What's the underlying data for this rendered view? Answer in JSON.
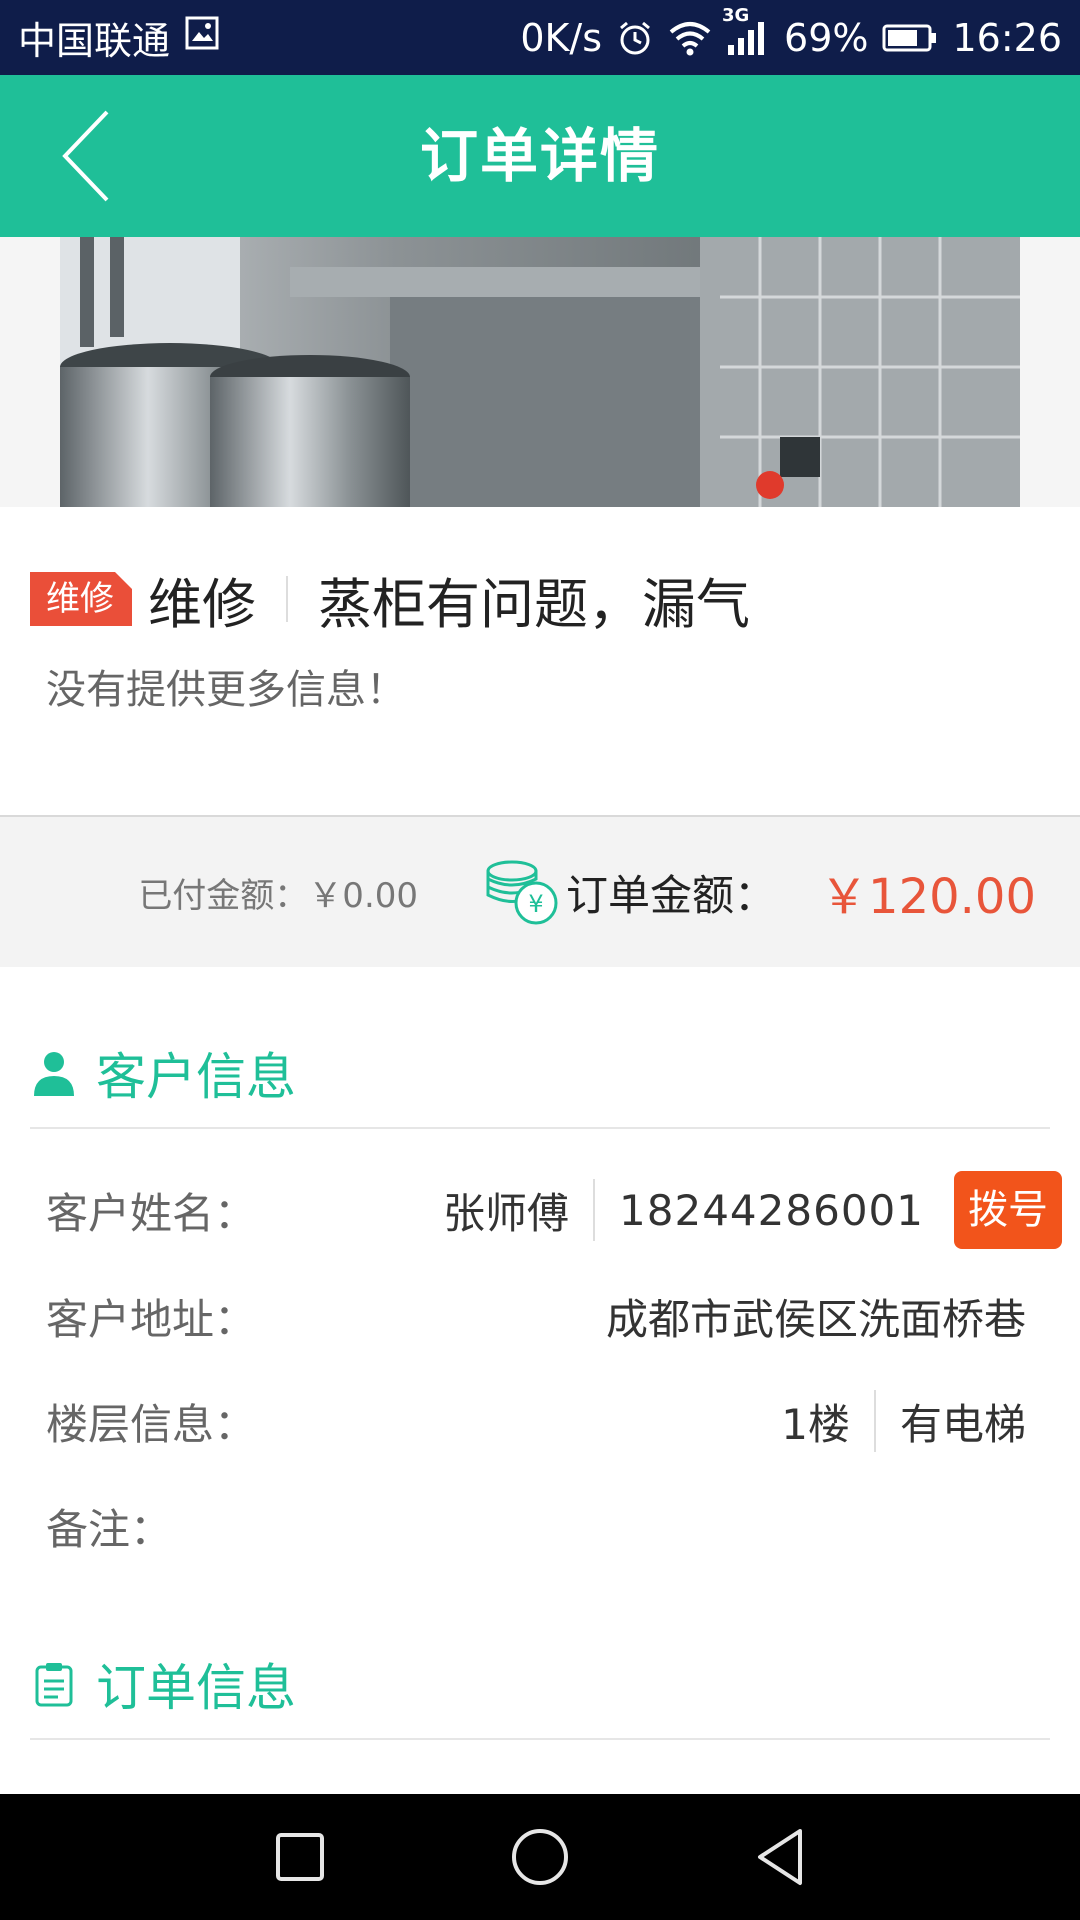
{
  "status_bar": {
    "carrier": "中国联通",
    "speed": "0K/s",
    "network": "3G",
    "battery": "69%",
    "time": "16:26"
  },
  "header": {
    "title": "订单详情",
    "back_icon": "chevron-left-icon"
  },
  "order": {
    "tag": "维修",
    "category": "维修",
    "subject": "蒸柜有问题，漏气",
    "description": "没有提供更多信息！"
  },
  "amounts": {
    "paid_label": "已付金额：",
    "paid_value": "￥0.00",
    "total_label": "订单金额：",
    "total_value": "￥120.00"
  },
  "customer_section": {
    "title": "客户信息",
    "name_label": "客户姓名：",
    "name_value": "张师傅",
    "phone": "18244286001",
    "dial_label": "拨号",
    "address_label": "客户地址：",
    "address_value": "成都市武侯区洗面桥巷",
    "floor_label": "楼层信息：",
    "floor_value": "1楼",
    "elevator_value": "有电梯",
    "remark_label": "备注："
  },
  "order_section": {
    "title": "订单信息"
  },
  "colors": {
    "accent": "#1fbf98",
    "status_bar": "#0f1d4a",
    "price": "#e8553a",
    "dial": "#f2541b",
    "tag": "#ea4f39"
  }
}
